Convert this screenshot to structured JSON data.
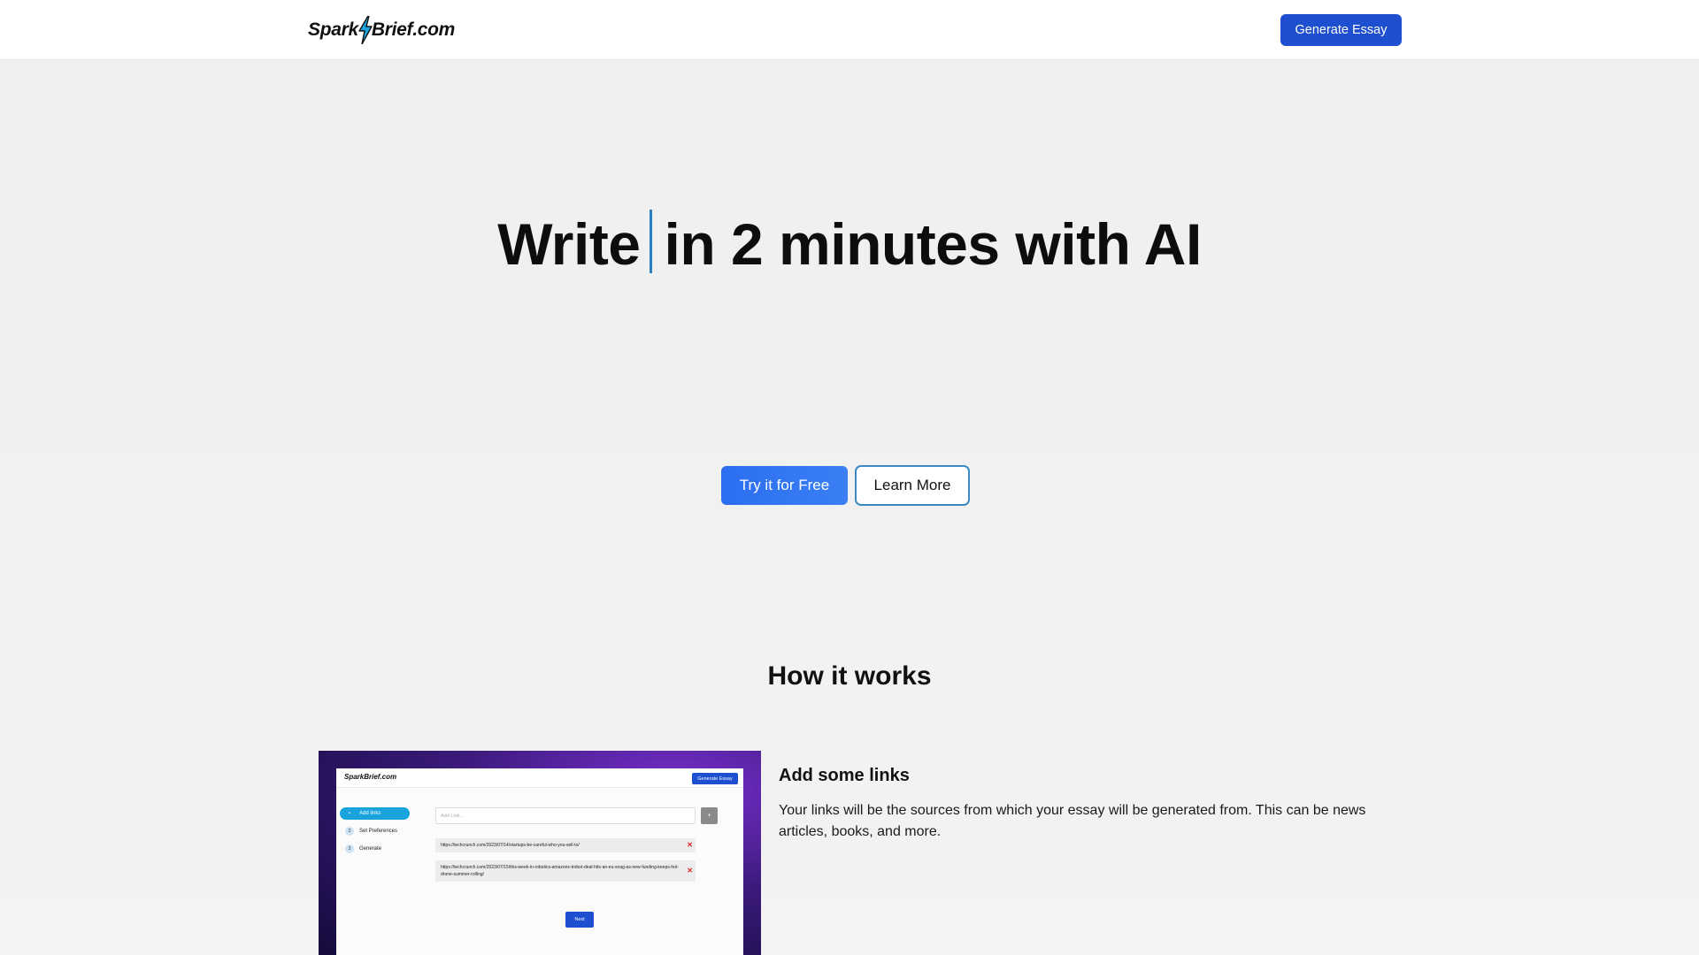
{
  "nav": {
    "logo_left": "Spark",
    "logo_right": "Brief.com",
    "generate_label": "Generate Essay"
  },
  "hero": {
    "headline_start": "Write",
    "headline_end": "in 2 minutes with AI",
    "primary_cta": "Try it for Free",
    "secondary_cta": "Learn More"
  },
  "how": {
    "title": "How it works",
    "step_title": "Add some links",
    "step_description": "Your links will be the sources from which your essay will be generated from. This can be news articles, books, and more."
  },
  "preview": {
    "logo": "SparkBrief.com",
    "generate_label": "Generate Essay",
    "steps": [
      {
        "num": "+",
        "label": "Add links"
      },
      {
        "num": "2",
        "label": "Set Preferences"
      },
      {
        "num": "3",
        "label": "Generate"
      }
    ],
    "input_placeholder": "Add Link...",
    "add_label": "+",
    "links": [
      "https://techcrunch.com/2023/07/14/startups-be-careful-who-you-sell-to/",
      "https://techcrunch.com/2023/07/15/this-week-in-robotics-amazons-trobot-deal-hits-an-eu-snag-as-new-funding-keeps-hot-drone-summer-rolling/"
    ],
    "remove_symbol": "✕",
    "next_label": "Next"
  },
  "colors": {
    "brand_blue": "#1e4fd1",
    "cta_blue": "#2b6ef0",
    "caret": "#2a7fc0",
    "accent_sky": "#19a3dd"
  }
}
